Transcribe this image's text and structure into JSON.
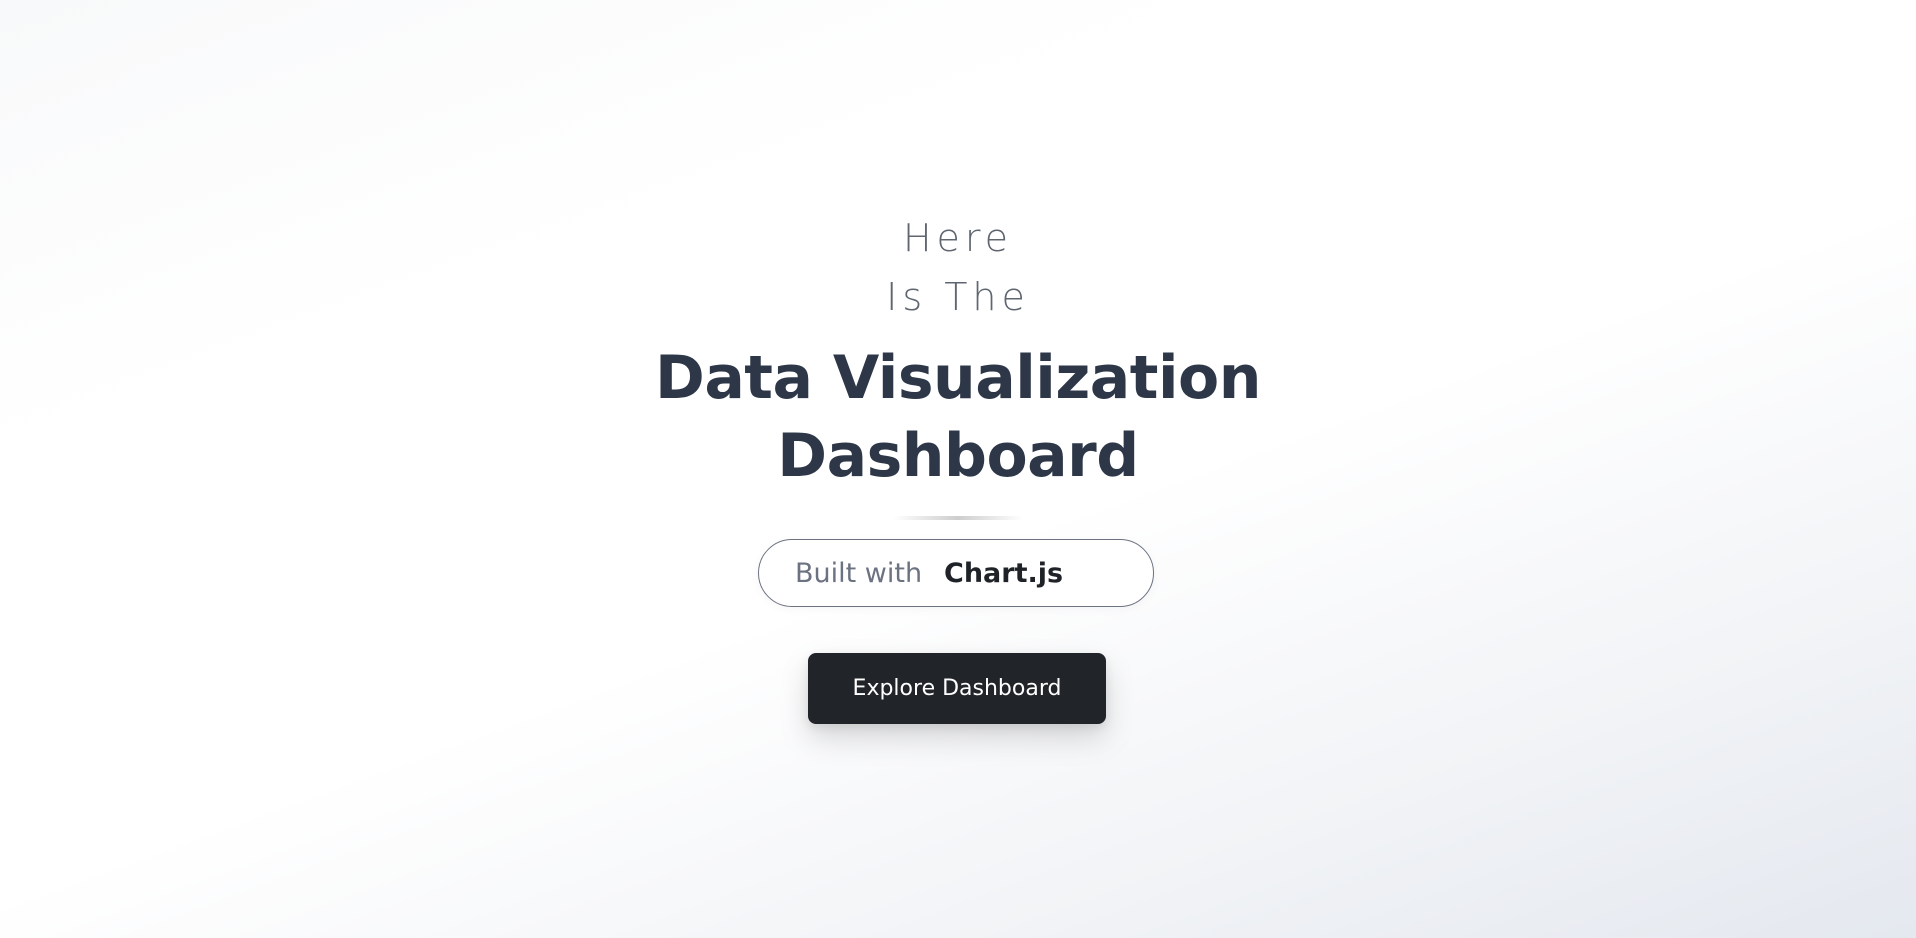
{
  "hero": {
    "intro_line_1": "Here",
    "intro_line_2": "Is The",
    "title_line_1": "Data Visualization",
    "title_line_2": "Dashboard",
    "built_with_label": "Built with",
    "library_name": "Chart.js",
    "cta_label": "Explore Dashboard"
  },
  "colors": {
    "title": "#2d3748",
    "intro": "#5f6670",
    "button_bg": "#212529",
    "button_text": "#ffffff",
    "pill_border": "#6b7280"
  }
}
